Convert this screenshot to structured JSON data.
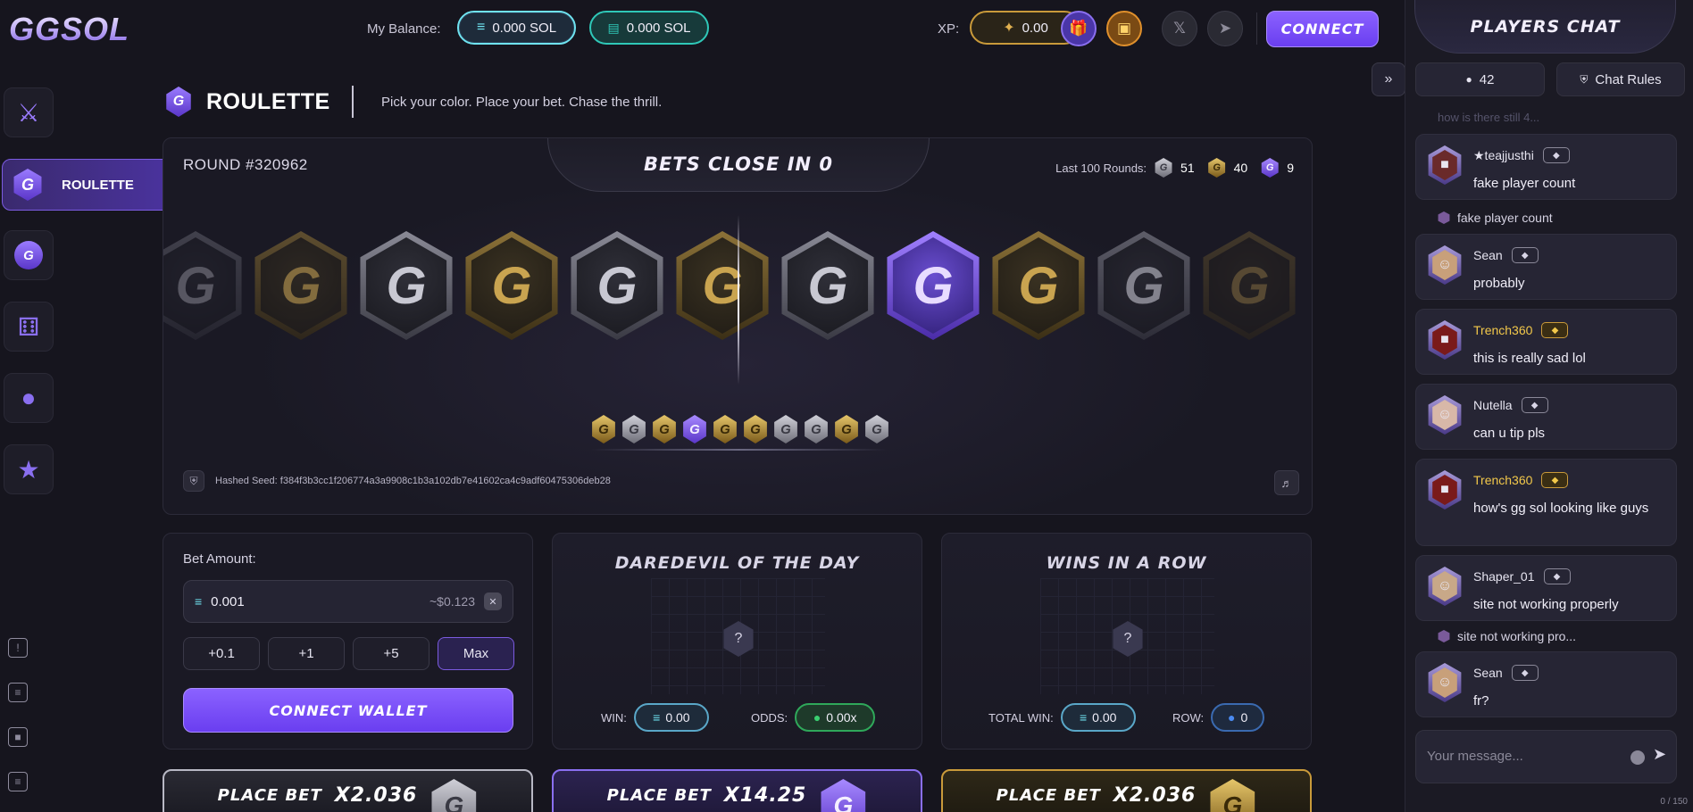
{
  "app": {
    "logo": "GGSOL"
  },
  "header": {
    "balance_label": "My Balance:",
    "sol_balance": "0.000 SOL",
    "ticket_balance": "0.000 SOL",
    "xp_label": "XP:",
    "xp_value": "0.00",
    "connect_label": "CONNECT"
  },
  "sidebar": {
    "active_label": "ROULETTE"
  },
  "page": {
    "title": "ROULETTE",
    "subtitle": "Pick your color. Place your bet. Chase the thrill."
  },
  "roulette": {
    "round": "ROUND #320962",
    "bets_close": "BETS CLOSE IN 0",
    "last100_label": "Last 100 Rounds:",
    "last100": [
      {
        "color": "silver",
        "count": "51"
      },
      {
        "color": "gold",
        "count": "40"
      },
      {
        "color": "purple",
        "count": "9"
      }
    ],
    "strip": [
      "silver",
      "gold",
      "silver",
      "gold",
      "silver",
      "gold",
      "silver",
      "purple",
      "gold",
      "silver",
      "gold"
    ],
    "history": [
      "gold",
      "silver",
      "gold",
      "purple",
      "gold",
      "gold",
      "silver",
      "silver",
      "gold",
      "silver"
    ],
    "tile_letter": "G",
    "seed_text": "Hashed Seed: f384f3b3cc1f206774a3a9908c1b3a102db7e41602ca4c9adf60475306deb28"
  },
  "bet": {
    "label": "Bet Amount:",
    "amount": "0.001",
    "usd": "~$0.123",
    "quick": [
      "+0.1",
      "+1",
      "+5",
      "Max"
    ],
    "wallet_button": "CONNECT WALLET"
  },
  "daredevil": {
    "title": "DAREDEVIL OF THE DAY",
    "win_label": "WIN:",
    "win_value": "0.00",
    "odds_label": "ODDS:",
    "odds_value": "0.00x"
  },
  "wins_row": {
    "title": "WINS IN A ROW",
    "total_label": "TOTAL WIN:",
    "total_value": "0.00",
    "row_label": "ROW:",
    "row_value": "0"
  },
  "place_bets": [
    {
      "label": "PLACE BET",
      "mult": "X2.036",
      "color": "silver"
    },
    {
      "label": "PLACE BET",
      "mult": "X14.25",
      "color": "purple"
    },
    {
      "label": "PLACE BET",
      "mult": "X2.036",
      "color": "gold"
    }
  ],
  "chat": {
    "title": "PLAYERS CHAT",
    "players_count": "42",
    "rules_label": "Chat Rules",
    "ghost": "how is there still 4...",
    "messages": [
      {
        "name": "★teajjusthi",
        "text": "fake player count",
        "gold": false
      },
      {
        "name": "Sean",
        "text": "probably",
        "gold": false
      },
      {
        "name": "Trench360",
        "text": "this is really sad lol",
        "gold": true
      },
      {
        "name": "Nutella",
        "text": "can u tip pls",
        "gold": false
      },
      {
        "name": "Trench360",
        "text": "how's gg sol looking like guys",
        "gold": true
      },
      {
        "name": "Shaper_01",
        "text": "site not working properly",
        "gold": false
      },
      {
        "name": "Sean",
        "text": "fr?",
        "gold": false
      }
    ],
    "replies": [
      "fake player count",
      "site not working pro..."
    ],
    "input_placeholder": "Your message...",
    "char_count": "0 / 150"
  }
}
